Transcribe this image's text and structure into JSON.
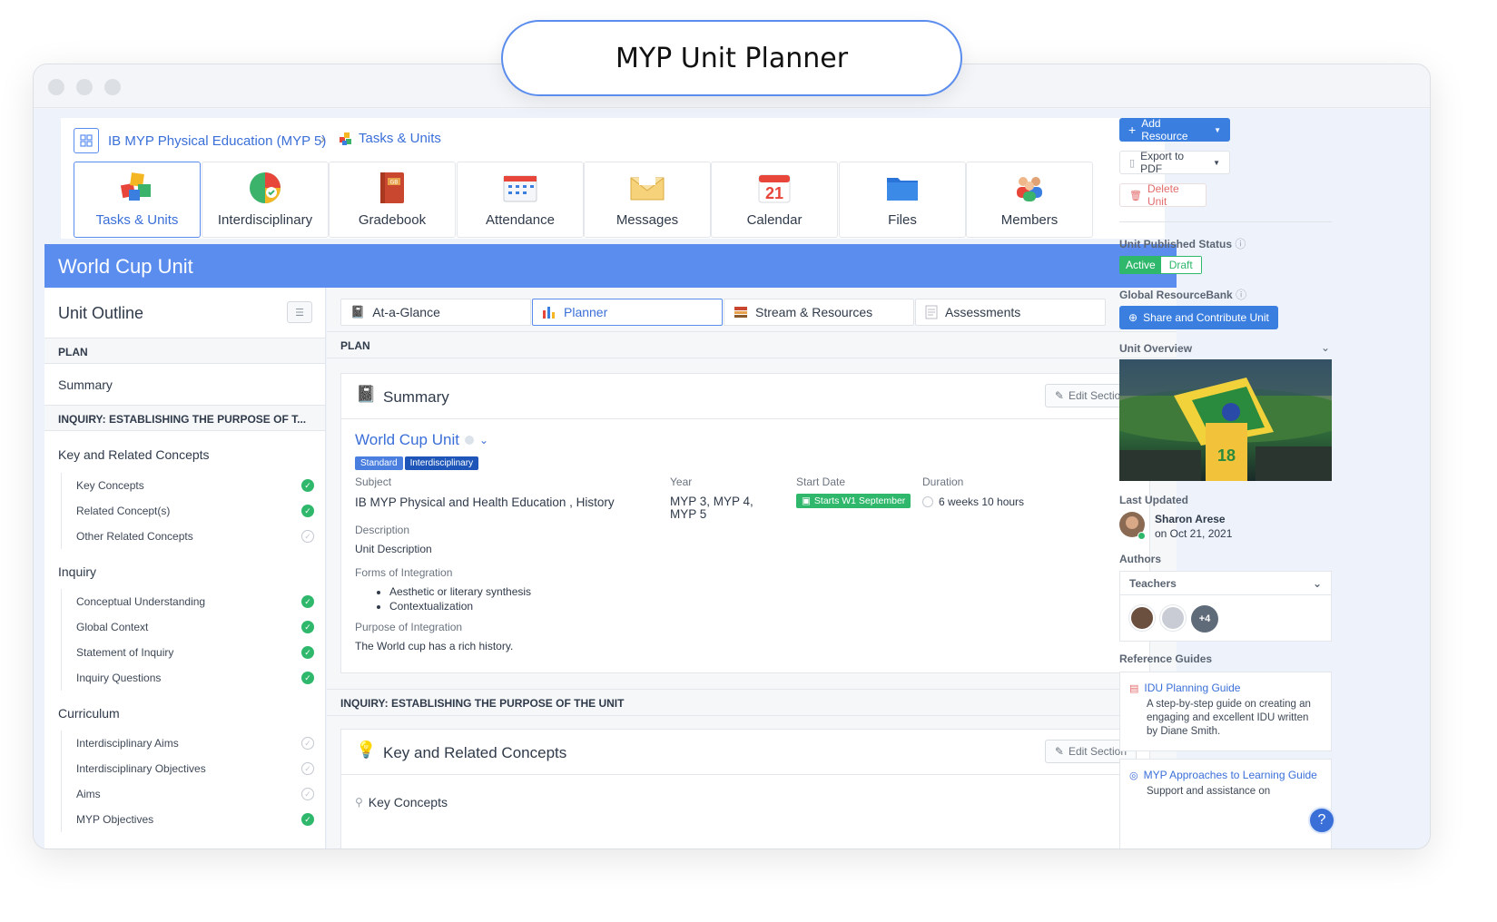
{
  "page_title": "MYP Unit Planner",
  "breadcrumb": {
    "course": "IB MYP Physical Education (MYP 5)",
    "separator": "›",
    "current": "Tasks & Units"
  },
  "apps": [
    {
      "label": "Tasks & Units",
      "icon": "puzzle-icon",
      "active": true
    },
    {
      "label": "Interdisciplinary",
      "icon": "globe-pie-icon",
      "active": false
    },
    {
      "label": "Gradebook",
      "icon": "gradebook-icon",
      "active": false
    },
    {
      "label": "Attendance",
      "icon": "attendance-icon",
      "active": false
    },
    {
      "label": "Messages",
      "icon": "envelope-icon",
      "active": false
    },
    {
      "label": "Calendar",
      "icon": "calendar-icon",
      "active": false,
      "badge": "21"
    },
    {
      "label": "Files",
      "icon": "folder-icon",
      "active": false
    },
    {
      "label": "Members",
      "icon": "members-icon",
      "active": false
    }
  ],
  "unit_title": "World Cup Unit",
  "outline": {
    "title": "Unit Outline",
    "plan_label": "PLAN",
    "summary": "Summary",
    "inquiry_label": "INQUIRY: ESTABLISHING THE PURPOSE OF T...",
    "groups": [
      {
        "title": "Key and Related Concepts",
        "items": [
          {
            "label": "Key Concepts",
            "done": true
          },
          {
            "label": "Related Concept(s)",
            "done": true
          },
          {
            "label": "Other Related Concepts",
            "done": false
          }
        ]
      },
      {
        "title": "Inquiry",
        "items": [
          {
            "label": "Conceptual Understanding",
            "done": true
          },
          {
            "label": "Global Context",
            "done": true
          },
          {
            "label": "Statement of Inquiry",
            "done": true
          },
          {
            "label": "Inquiry Questions",
            "done": true
          }
        ]
      },
      {
        "title": "Curriculum",
        "items": [
          {
            "label": "Interdisciplinary Aims",
            "done": false
          },
          {
            "label": "Interdisciplinary Objectives",
            "done": false
          },
          {
            "label": "Aims",
            "done": false
          },
          {
            "label": "MYP Objectives",
            "done": true
          }
        ]
      }
    ]
  },
  "tabs": [
    {
      "label": "At-a-Glance",
      "icon": "notebook-icon",
      "active": false
    },
    {
      "label": "Planner",
      "icon": "bar-chart-icon",
      "active": true
    },
    {
      "label": "Stream & Resources",
      "icon": "stack-icon",
      "active": false
    },
    {
      "label": "Assessments",
      "icon": "document-icon",
      "active": false
    }
  ],
  "plan_label": "PLAN",
  "summary_card": {
    "title": "Summary",
    "edit_label": "Edit Section",
    "unit_link": "World Cup Unit",
    "tags": [
      {
        "label": "Standard",
        "color": "#4a7fe0"
      },
      {
        "label": "Interdisciplinary",
        "color": "#1d56b8"
      }
    ],
    "subject_label": "Subject",
    "subject_value": "IB MYP Physical and Health Education , History",
    "year_label": "Year",
    "year_value": "MYP 3, MYP 4, MYP 5",
    "start_label": "Start Date",
    "start_value": "Starts W1 September",
    "duration_label": "Duration",
    "duration_value": "6 weeks 10 hours",
    "description_label": "Description",
    "description_value": "Unit Description",
    "forms_label": "Forms of Integration",
    "forms": [
      "Aesthetic or literary synthesis",
      "Contextualization"
    ],
    "purpose_label": "Purpose of Integration",
    "purpose_value": "The World cup has a rich history."
  },
  "inquiry_bar": "INQUIRY: ESTABLISHING THE PURPOSE OF THE UNIT",
  "concepts_card": {
    "title": "Key and Related Concepts",
    "edit_label": "Edit Section",
    "sub": "Key Concepts"
  },
  "sidebar": {
    "add_resource": "Add Resource",
    "export_pdf": "Export to PDF",
    "delete_unit": "Delete Unit",
    "published_label": "Unit Published Status",
    "status_active": "Active",
    "status_draft": "Draft",
    "resourcebank_label": "Global ResourceBank",
    "share_label": "Share and Contribute Unit",
    "overview_label": "Unit Overview",
    "last_updated_label": "Last Updated",
    "updated_by": "Sharon Arese",
    "updated_on": "on Oct 21, 2021",
    "authors_label": "Authors",
    "authors_select": "Teachers",
    "authors_more": "+4",
    "reference_label": "Reference Guides",
    "guides": [
      {
        "title": "IDU Planning Guide",
        "desc": "A step-by-step guide on creating an engaging and excellent IDU written by Diane Smith."
      },
      {
        "title": "MYP Approaches to Learning Guide",
        "desc": "Support and assistance on"
      }
    ]
  },
  "colors": {
    "accent": "#5b8def",
    "success": "#2fb86c",
    "danger": "#e36b6b"
  }
}
